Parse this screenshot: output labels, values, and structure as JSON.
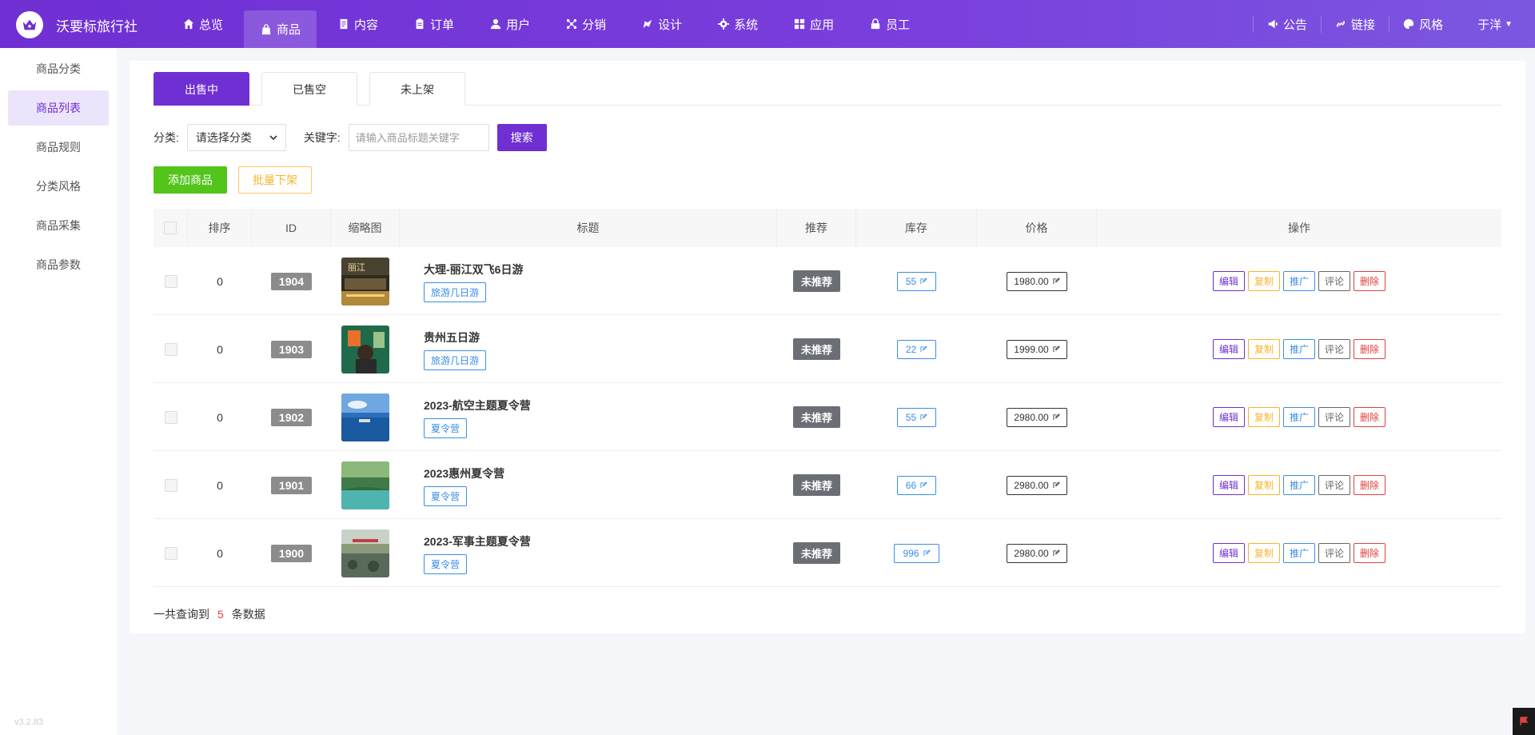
{
  "brand": {
    "name": "沃要标旅行社"
  },
  "nav": [
    {
      "label": "总览",
      "icon": "home-icon"
    },
    {
      "label": "商品",
      "icon": "bag-icon",
      "active": true
    },
    {
      "label": "内容",
      "icon": "document-icon"
    },
    {
      "label": "订单",
      "icon": "clipboard-icon"
    },
    {
      "label": "用户",
      "icon": "user-icon"
    },
    {
      "label": "分销",
      "icon": "network-icon"
    },
    {
      "label": "设计",
      "icon": "palette-icon"
    },
    {
      "label": "系统",
      "icon": "gear-icon"
    },
    {
      "label": "应用",
      "icon": "grid-icon"
    },
    {
      "label": "员工",
      "icon": "lock-icon"
    }
  ],
  "topright": {
    "notice": "公告",
    "link": "链接",
    "style": "风格",
    "user": "于洋"
  },
  "sidebar": {
    "items": [
      "商品分类",
      "商品列表",
      "商品规则",
      "分类风格",
      "商品采集",
      "商品参数"
    ],
    "active_index": 1,
    "version": "v3.2.83"
  },
  "tabs": [
    "出售中",
    "已售空",
    "未上架"
  ],
  "filter": {
    "category_label": "分类:",
    "category_value": "请选择分类",
    "keyword_label": "关键字:",
    "keyword_placeholder": "请输入商品标题关键字",
    "search_button": "搜索"
  },
  "actions": {
    "add": "添加商品",
    "batch_off": "批量下架"
  },
  "table": {
    "headers": [
      "",
      "排序",
      "ID",
      "缩略图",
      "标题",
      "推荐",
      "库存",
      "价格",
      "操作"
    ],
    "rows": [
      {
        "sort": "0",
        "id": "1904",
        "title": "大理-丽江双飞6日游",
        "tag": "旅游几日游",
        "recommend": "未推荐",
        "stock": "55",
        "price": "1980.00"
      },
      {
        "sort": "0",
        "id": "1903",
        "title": "贵州五日游",
        "tag": "旅游几日游",
        "recommend": "未推荐",
        "stock": "22",
        "price": "1999.00"
      },
      {
        "sort": "0",
        "id": "1902",
        "title": "2023-航空主题夏令营",
        "tag": "夏令营",
        "recommend": "未推荐",
        "stock": "55",
        "price": "2980.00"
      },
      {
        "sort": "0",
        "id": "1901",
        "title": "2023惠州夏令营",
        "tag": "夏令营",
        "recommend": "未推荐",
        "stock": "66",
        "price": "2980.00"
      },
      {
        "sort": "0",
        "id": "1900",
        "title": "2023-军事主题夏令营",
        "tag": "夏令营",
        "recommend": "未推荐",
        "stock": "996",
        "price": "2980.00"
      }
    ],
    "ops": [
      "编辑",
      "复制",
      "推广",
      "评论",
      "删除"
    ]
  },
  "summary": {
    "prefix": "一共查询到",
    "count": "5",
    "suffix": "条数据"
  },
  "colors": {
    "primary": "#6f2fd3",
    "green": "#52c41a",
    "warning": "#f7b52c",
    "blue": "#3a8ee6",
    "danger": "#e0403f"
  }
}
